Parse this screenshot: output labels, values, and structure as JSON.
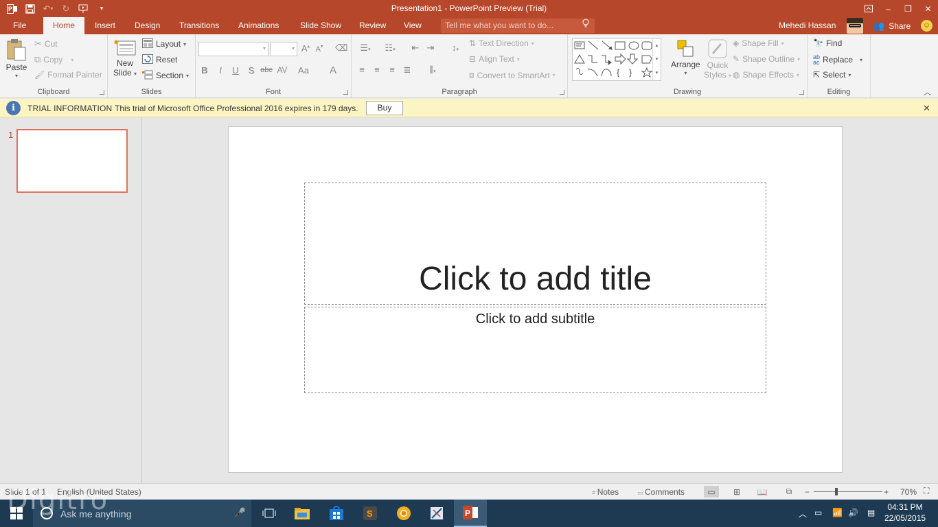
{
  "window": {
    "title": "Presentation1 - PowerPoint Preview (Trial)"
  },
  "qat": {
    "app_icon": "powerpoint-icon",
    "save": "save-icon",
    "undo": "undo-icon",
    "redo": "redo-icon",
    "start_from_beginning": "slideshow-start-icon",
    "customize": "customize-qat-icon"
  },
  "tabs": [
    "File",
    "Home",
    "Insert",
    "Design",
    "Transitions",
    "Animations",
    "Slide Show",
    "Review",
    "View"
  ],
  "active_tab": "Home",
  "tell_me": {
    "placeholder": "Tell me what you want to do..."
  },
  "user": {
    "name": "Mehedi Hassan"
  },
  "share": {
    "label": "Share"
  },
  "ribbon": {
    "clipboard": {
      "label": "Clipboard",
      "paste": "Paste",
      "cut": "Cut",
      "copy": "Copy",
      "format_painter": "Format Painter"
    },
    "slides": {
      "label": "Slides",
      "new_slide_1": "New",
      "new_slide_2": "Slide",
      "layout": "Layout",
      "reset": "Reset",
      "section": "Section"
    },
    "font": {
      "label": "Font",
      "font_name": "",
      "font_size": "",
      "bold": "B",
      "italic": "I",
      "underline": "U",
      "shadow": "S",
      "strikethrough": "abc",
      "spacing": "AV",
      "change_case": "Aa",
      "grow": "A",
      "shrink": "A",
      "color": "A"
    },
    "paragraph": {
      "label": "Paragraph",
      "text_direction": "Text Direction",
      "align_text": "Align Text",
      "convert_smartart": "Convert to SmartArt"
    },
    "drawing": {
      "label": "Drawing",
      "arrange": "Arrange",
      "quick_styles_1": "Quick",
      "quick_styles_2": "Styles",
      "shape_fill": "Shape Fill",
      "shape_outline": "Shape Outline",
      "shape_effects": "Shape Effects"
    },
    "editing": {
      "label": "Editing",
      "find": "Find",
      "replace": "Replace",
      "select": "Select"
    }
  },
  "trial": {
    "heading": "TRIAL INFORMATION",
    "message": "This trial of Microsoft Office Professional 2016 expires in 179 days.",
    "buy": "Buy"
  },
  "thumbnails": [
    {
      "number": "1"
    }
  ],
  "slide": {
    "title_placeholder": "Click to add title",
    "subtitle_placeholder": "Click to add subtitle"
  },
  "status": {
    "slide_info": "Slide 1 of 1",
    "language": "English (United States)",
    "notes": "Notes",
    "comments": "Comments",
    "zoom": "70%"
  },
  "taskbar": {
    "search_placeholder": "Ask me anything",
    "time": "04:31 PM",
    "date": "22/05/2015"
  },
  "watermark": "Digitro"
}
